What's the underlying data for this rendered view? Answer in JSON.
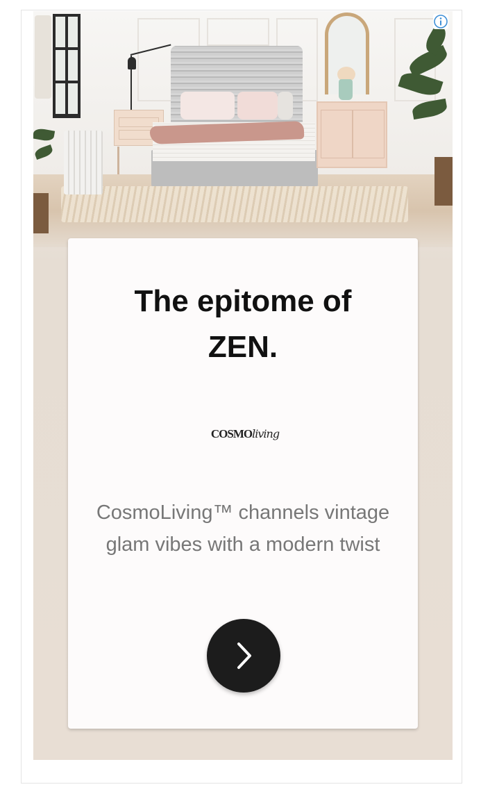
{
  "ad": {
    "headline_line1": "The epitome of",
    "headline_line2": "ZEN.",
    "logo_text_bold": "COSMO",
    "logo_text_script": "living",
    "description": "CosmoLiving™ channels vintage glam vibes with a modern twist",
    "cta_icon": "chevron-right-icon",
    "adchoices_icon": "info-icon"
  },
  "colors": {
    "card_background": "#fdfbfb",
    "ad_background": "#e8ded4",
    "headline": "#111111",
    "description": "#777777",
    "cta_background": "#1c1c1c",
    "adchoices_blue": "#3e8fd6"
  }
}
